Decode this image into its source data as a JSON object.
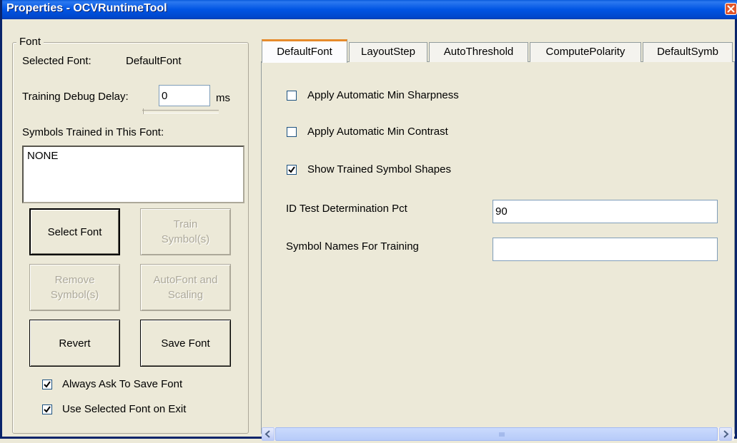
{
  "window": {
    "title": "Properties - OCVRuntimeTool"
  },
  "font_group": {
    "legend": "Font",
    "selected_font_label": "Selected Font:",
    "selected_font_value": "DefaultFont",
    "debug_delay_label": "Training Debug Delay:",
    "debug_delay_value": "0",
    "debug_delay_unit": "ms",
    "symbols_trained_label": "Symbols Trained in This Font:",
    "symbols_trained_value": "NONE",
    "buttons": {
      "select_font": "Select Font",
      "train_symbols_1": "Train",
      "train_symbols_2": "Symbol(s)",
      "remove_symbols_1": "Remove",
      "remove_symbols_2": "Symbol(s)",
      "autofont_1": "AutoFont and",
      "autofont_2": "Scaling",
      "revert": "Revert",
      "save_font": "Save Font"
    },
    "always_ask_label": "Always Ask To Save Font",
    "always_ask_checked": true,
    "use_selected_label": "Use Selected Font on Exit",
    "use_selected_checked": true
  },
  "tabs": [
    "DefaultFont",
    "LayoutStep",
    "AutoThreshold",
    "ComputePolarity",
    "DefaultSymb"
  ],
  "default_font_tab": {
    "auto_sharpness_label": "Apply Automatic Min Sharpness",
    "auto_sharpness_checked": false,
    "auto_contrast_label": "Apply Automatic Min Contrast",
    "auto_contrast_checked": false,
    "show_shapes_label": "Show Trained Symbol Shapes",
    "show_shapes_checked": true,
    "id_test_label": "ID Test Determination Pct",
    "id_test_value": "90",
    "symbol_names_label": "Symbol Names For Training",
    "symbol_names_value": ""
  },
  "colors": {
    "title_bar": "#0054E3",
    "window_bg": "#ECE9D8",
    "active_tab_accent": "#E68B2C",
    "close_button": "#E2562B"
  },
  "icons": [
    "close-icon",
    "check-icon",
    "scroll-left-icon",
    "scroll-right-icon",
    "scroll-grip-icon"
  ]
}
